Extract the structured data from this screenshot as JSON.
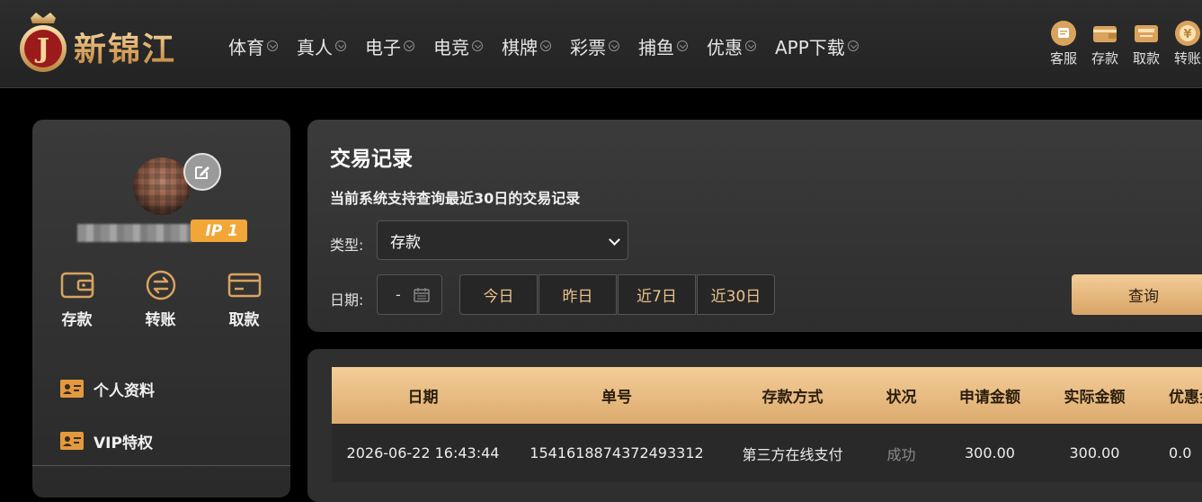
{
  "brand": {
    "name": "新锦江",
    "badge_letter": "J"
  },
  "nav": [
    {
      "label": "体育"
    },
    {
      "label": "真人"
    },
    {
      "label": "电子"
    },
    {
      "label": "电竞"
    },
    {
      "label": "棋牌"
    },
    {
      "label": "彩票"
    },
    {
      "label": "捕鱼"
    },
    {
      "label": "优惠"
    },
    {
      "label": "APP下载"
    }
  ],
  "quick_actions": [
    {
      "label": "客服",
      "icon": "chat-icon"
    },
    {
      "label": "存款",
      "icon": "wallet-icon"
    },
    {
      "label": "取款",
      "icon": "atm-icon"
    },
    {
      "label": "转账",
      "icon": "transfer-coin-icon"
    }
  ],
  "profile": {
    "vip_label": "IP 1"
  },
  "wallet_actions": [
    {
      "label": "存款",
      "icon": "wallet-icon"
    },
    {
      "label": "转账",
      "icon": "transfer-icon"
    },
    {
      "label": "取款",
      "icon": "card-icon"
    }
  ],
  "side_menu": [
    {
      "label": "个人资料",
      "icon": "id-card-icon"
    },
    {
      "label": "VIP特权",
      "icon": "id-card-icon"
    }
  ],
  "records": {
    "title": "交易记录",
    "note": "当前系统支持查询最近30日的交易记录",
    "type_label": "类型:",
    "type_value": "存款",
    "date_label": "日期:",
    "date_value": "-",
    "ranges": [
      "今日",
      "昨日",
      "近7日",
      "近30日"
    ],
    "query_label": "查询"
  },
  "table": {
    "headers": [
      "日期",
      "单号",
      "存款方式",
      "状况",
      "申请金额",
      "实际金额",
      "优惠金"
    ],
    "rows": [
      [
        "2026-06-22 16:43:44",
        "1541618874372493312",
        "第三方在线支付",
        "成功",
        "300.00",
        "300.00",
        "0.0"
      ]
    ]
  },
  "colors": {
    "accent_gold": "#e9c28a",
    "vip_orange": "#f2a638",
    "background": "#000000"
  }
}
